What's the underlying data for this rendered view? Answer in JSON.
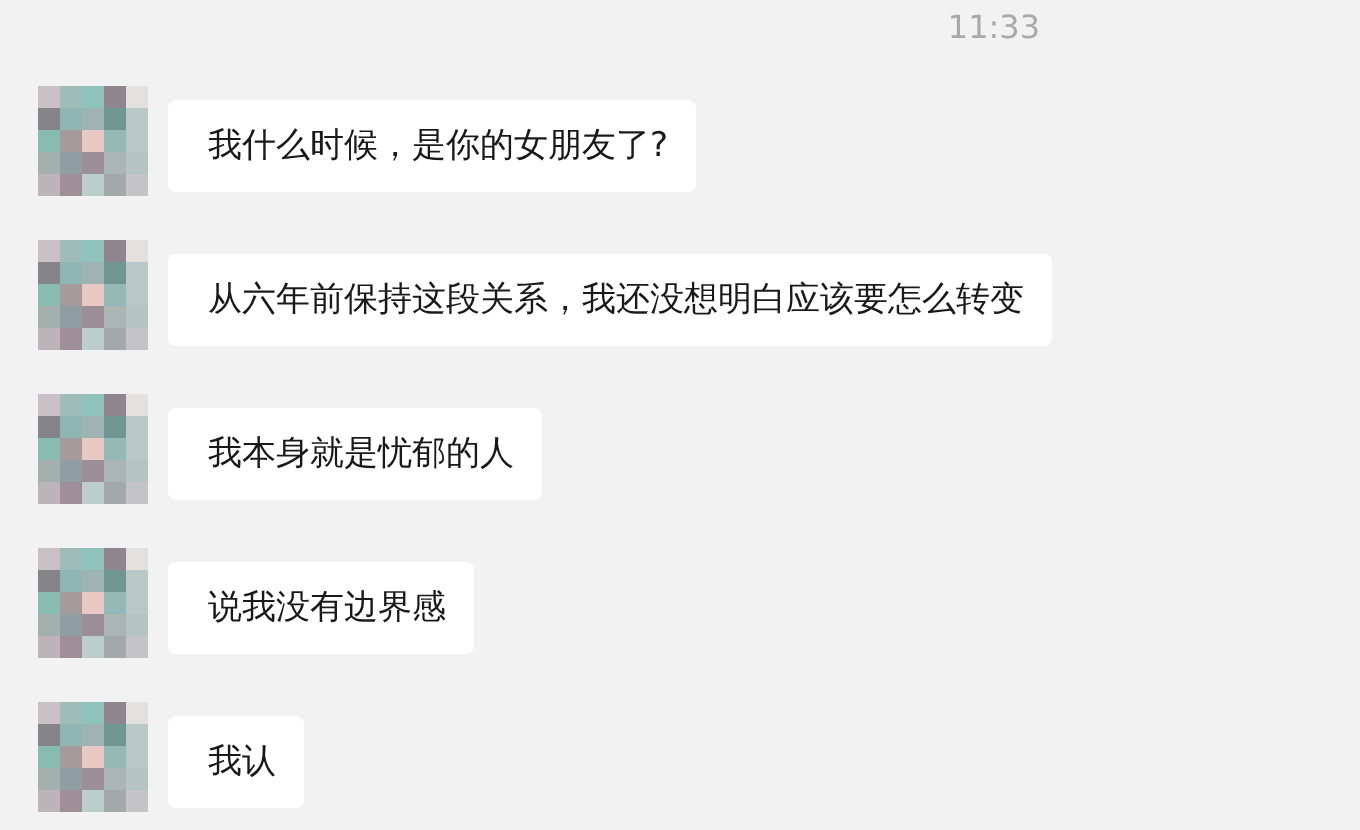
{
  "timestamp": "11:33",
  "messages": [
    {
      "text": "我什么时候，是你的女朋友了?"
    },
    {
      "text": "从六年前保持这段关系，我还没想明白应该要怎么转变"
    },
    {
      "text": "我本身就是忧郁的人"
    },
    {
      "text": "说我没有边界感"
    },
    {
      "text": "我认"
    }
  ]
}
